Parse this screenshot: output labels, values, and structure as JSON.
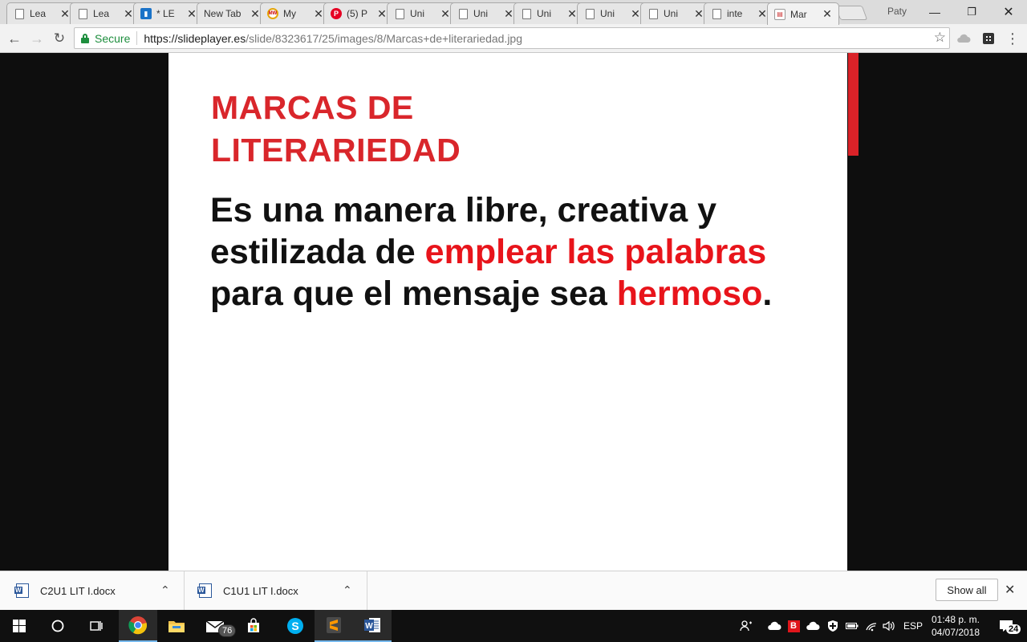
{
  "browser": {
    "tabs": [
      {
        "label": "Lea",
        "icon": "doc-icon",
        "active": false
      },
      {
        "label": "Lea",
        "icon": "doc-icon",
        "active": false
      },
      {
        "label": "* LE",
        "icon": "le-icon",
        "active": false
      },
      {
        "label": "New Tab",
        "icon": "none",
        "active": false
      },
      {
        "label": "My",
        "icon": "mw-icon",
        "active": false
      },
      {
        "label": "(5) P",
        "icon": "pinterest-icon",
        "active": false
      },
      {
        "label": "Uni",
        "icon": "doc-icon",
        "active": false
      },
      {
        "label": "Uni",
        "icon": "doc-icon",
        "active": false
      },
      {
        "label": "Uni",
        "icon": "doc-icon",
        "active": false
      },
      {
        "label": "Uni",
        "icon": "doc-icon",
        "active": false
      },
      {
        "label": "Uni",
        "icon": "doc-icon",
        "active": false
      },
      {
        "label": "inte",
        "icon": "doc-icon",
        "active": false
      },
      {
        "label": "Mar",
        "icon": "slideplayer-icon",
        "active": true
      }
    ],
    "profile_name": "Paty",
    "address": {
      "secure_label": "Secure",
      "url_host": "https://slideplayer.es",
      "url_path": "/slide/8323617/25/images/8/Marcas+de+literariedad.jpg"
    }
  },
  "slide": {
    "title_line1": "MARCAS DE",
    "title_line2": "LITERARIEDAD",
    "body_plain1": "Es una manera libre, creativa y estilizada de ",
    "body_highlight1": "emplear las palabras",
    "body_plain2": " para que el mensaje sea ",
    "body_highlight2": "hermoso",
    "body_end": ".",
    "accent_color": "#d9262b",
    "highlight_color": "#e8141b"
  },
  "downloads": {
    "items": [
      {
        "filename": "C2U1 LIT I.docx"
      },
      {
        "filename": "C1U1 LIT I.docx"
      }
    ],
    "show_all_label": "Show all"
  },
  "taskbar": {
    "mail_badge": "76",
    "language": "ESP",
    "time": "01:48 p. m.",
    "date": "04/07/2018",
    "notification_count": "24"
  }
}
